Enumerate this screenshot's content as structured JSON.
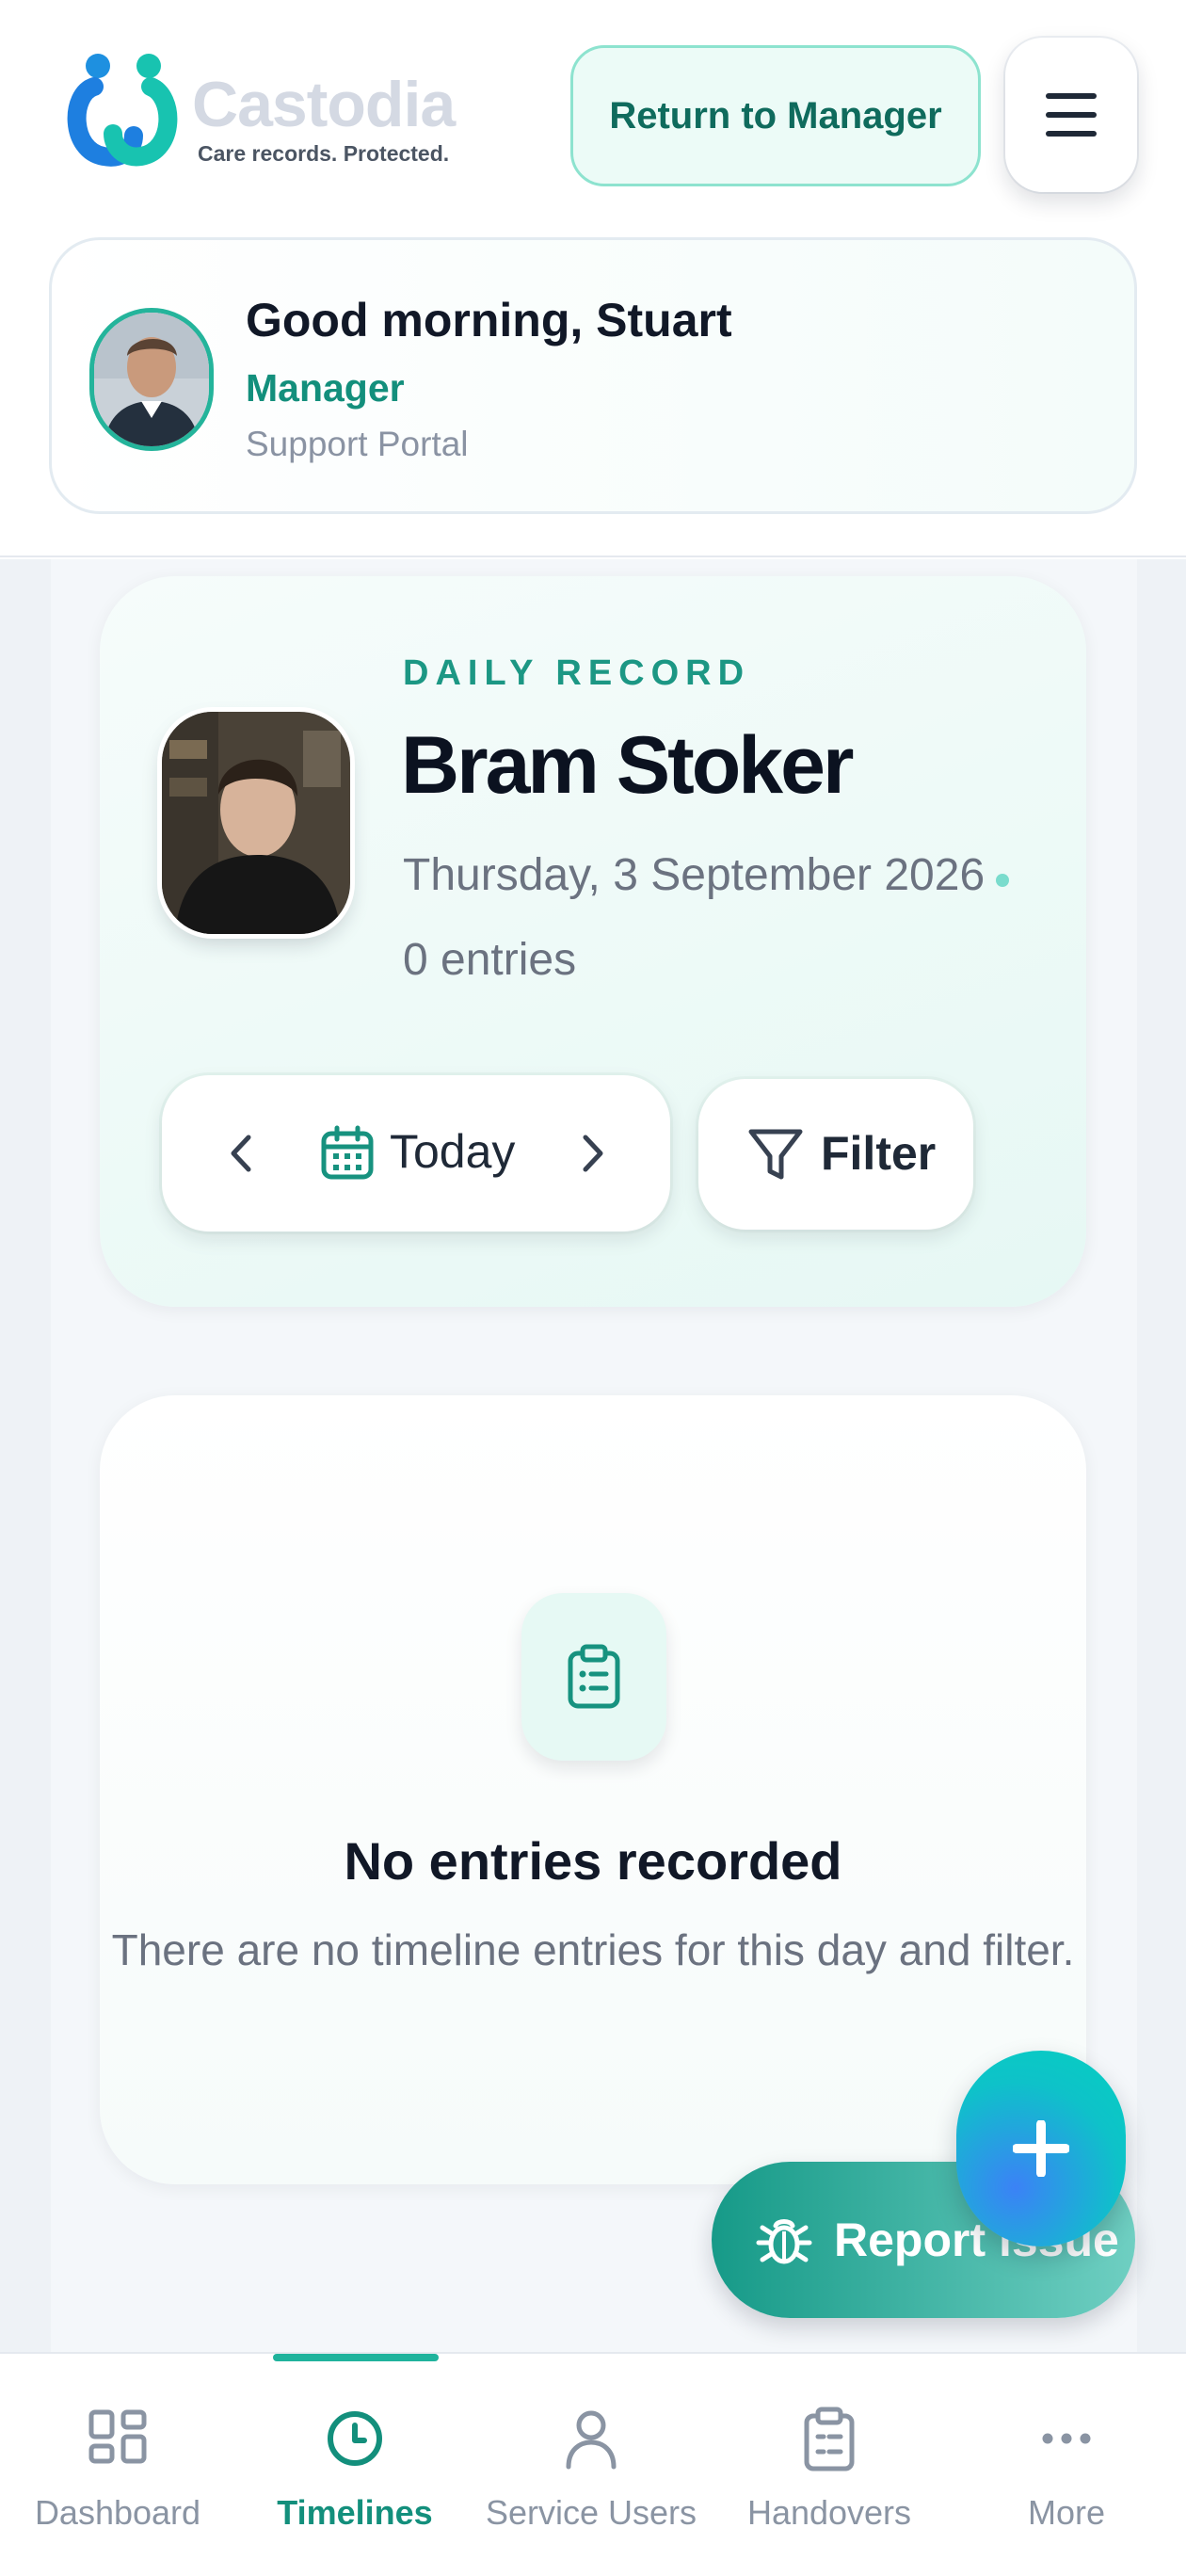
{
  "header": {
    "brand_name": "Castodia",
    "brand_tagline": "Care records. Protected.",
    "return_label": "Return to Manager",
    "menu_icon": "hamburger-menu-icon"
  },
  "greeting": {
    "title": "Good morning, Stuart",
    "role": "Manager",
    "portal": "Support Portal"
  },
  "record": {
    "kicker": "DAILY RECORD",
    "person_name": "Bram Stoker",
    "date": "Thursday, 3 September 2026",
    "entries": "0 entries",
    "day_label": "Today",
    "filter_label": "Filter"
  },
  "empty_state": {
    "title": "No entries recorded",
    "subtitle": "There are no timeline entries for this day and filter."
  },
  "actions": {
    "report_label": "Report issue",
    "fab_icon": "plus-icon"
  },
  "bottom_nav": {
    "items": [
      {
        "label": "Dashboard",
        "icon": "dashboard-icon"
      },
      {
        "label": "Timelines",
        "icon": "clock-icon",
        "active": true
      },
      {
        "label": "Service Users",
        "icon": "user-icon"
      },
      {
        "label": "Handovers",
        "icon": "clipboard-icon"
      },
      {
        "label": "More",
        "icon": "more-dots-icon"
      }
    ]
  },
  "colors": {
    "accent": "#138f7c",
    "accent_light": "#ecfbf7",
    "brand_blue": "#1e90e0"
  }
}
